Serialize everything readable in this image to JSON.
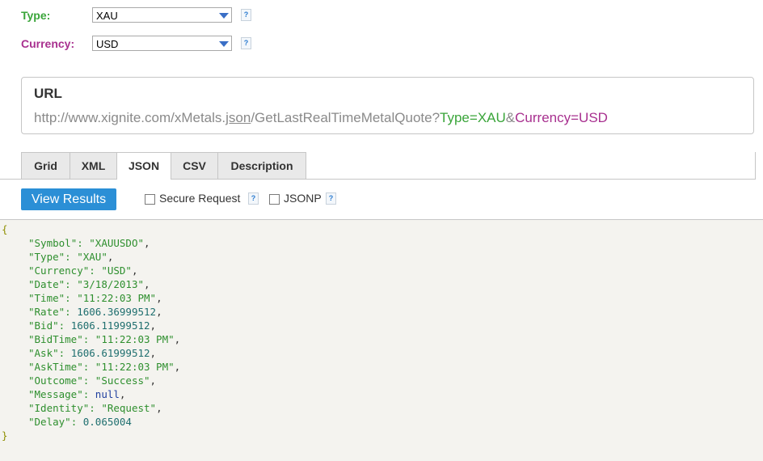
{
  "fields": {
    "type": {
      "label": "Type:",
      "value": "XAU",
      "help": "?"
    },
    "currency": {
      "label": "Currency:",
      "value": "USD",
      "help": "?"
    }
  },
  "url": {
    "title": "URL",
    "base": "http://www.xignite.com/xMetals.",
    "format": "json",
    "path": "/GetLastRealTimeMetalQuote?",
    "param1_name": "Type",
    "eq1": "=",
    "param1_value": "XAU",
    "amp": "&",
    "param2_name": "Currency",
    "eq2": "=",
    "param2_value": "USD"
  },
  "tabs": [
    {
      "label": "Grid"
    },
    {
      "label": "XML"
    },
    {
      "label": "JSON",
      "active": true
    },
    {
      "label": "CSV"
    },
    {
      "label": "Description"
    }
  ],
  "actions": {
    "view_results": "View Results",
    "secure_request": "Secure Request",
    "jsonp": "JSONP",
    "help": "?"
  },
  "json_output": {
    "open": "{",
    "close": "}",
    "entries": [
      {
        "key": "Symbol",
        "value": "\"XAUUSDO\"",
        "kind": "str"
      },
      {
        "key": "Type",
        "value": "\"XAU\"",
        "kind": "str"
      },
      {
        "key": "Currency",
        "value": "\"USD\"",
        "kind": "str"
      },
      {
        "key": "Date",
        "value": "\"3/18/2013\"",
        "kind": "str"
      },
      {
        "key": "Time",
        "value": "\"11:22:03 PM\"",
        "kind": "str"
      },
      {
        "key": "Rate",
        "value": "1606.36999512",
        "kind": "num"
      },
      {
        "key": "Bid",
        "value": "1606.11999512",
        "kind": "num"
      },
      {
        "key": "BidTime",
        "value": "\"11:22:03 PM\"",
        "kind": "str"
      },
      {
        "key": "Ask",
        "value": "1606.61999512",
        "kind": "num"
      },
      {
        "key": "AskTime",
        "value": "\"11:22:03 PM\"",
        "kind": "str"
      },
      {
        "key": "Outcome",
        "value": "\"Success\"",
        "kind": "str"
      },
      {
        "key": "Message",
        "value": "null",
        "kind": "null"
      },
      {
        "key": "Identity",
        "value": "\"Request\"",
        "kind": "str"
      },
      {
        "key": "Delay",
        "value": "0.065004",
        "kind": "num"
      }
    ]
  },
  "colors": {
    "type_green": "#3aa53a",
    "currency_magenta": "#a8308f",
    "button_blue": "#2b8fd6"
  }
}
